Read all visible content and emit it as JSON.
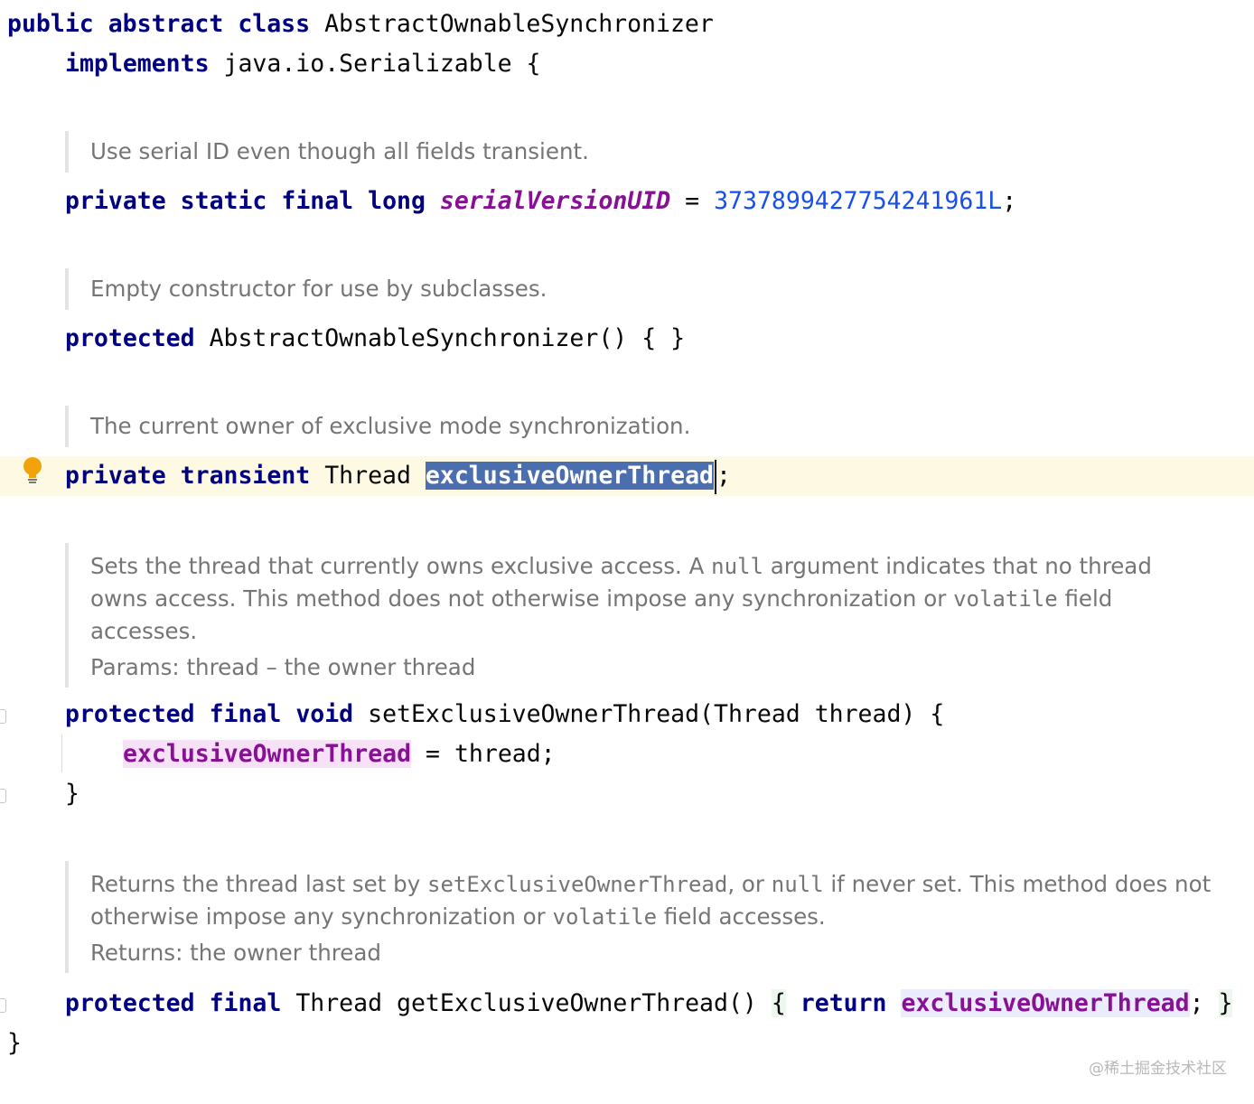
{
  "code": {
    "l1": {
      "kw1": "public",
      "kw2": "abstract",
      "kw3": "class",
      "name": "AbstractOwnableSynchronizer"
    },
    "l2": {
      "kw": "implements",
      "rest": "java.io.Serializable {"
    },
    "doc1": "Use serial ID even though all fields transient.",
    "l3": {
      "kw1": "private",
      "kw2": "static",
      "kw3": "final",
      "kw4": "long",
      "field": "serialVersionUID",
      "eq": "=",
      "num": "3737899427754241961L",
      "semi": ";"
    },
    "doc2": "Empty constructor for use by subclasses.",
    "l4": {
      "kw": "protected",
      "rest": "AbstractOwnableSynchronizer() { }"
    },
    "doc3": "The current owner of exclusive mode synchronization.",
    "l5": {
      "kw1": "private",
      "kw2": "transient",
      "type": "Thread",
      "field": "exclusiveOwnerThread",
      "semi": ";"
    },
    "doc4": {
      "t1": "Sets the thread that currently owns exclusive access. A ",
      "c1": "null",
      "t2": " argument indicates that no thread owns access. This method does not otherwise impose any synchronization or ",
      "c2": "volatile",
      "t3": " field accesses.",
      "params": "Params: thread – the owner thread"
    },
    "l6": {
      "kw1": "protected",
      "kw2": "final",
      "kw3": "void",
      "rest": "setExclusiveOwnerThread(Thread thread) {"
    },
    "l7": {
      "field": "exclusiveOwnerThread",
      "rest": " = thread;"
    },
    "l8": {
      "brace": "}"
    },
    "doc5": {
      "t1": "Returns the thread last set by ",
      "c1": "setExclusiveOwnerThread",
      "t2": ", or ",
      "c2": "null",
      "t3": " if never set. This method does not otherwise impose any synchronization or ",
      "c3": "volatile",
      "t4": " field accesses.",
      "returns": "Returns: the owner thread"
    },
    "l9": {
      "kw1": "protected",
      "kw2": "final",
      "type": "Thread",
      "method": "getExclusiveOwnerThread()",
      "ob": "{",
      "kw3": "return",
      "field": "exclusiveOwnerThread",
      "semi": ";",
      "cb": "}"
    },
    "l10": {
      "brace": "}"
    }
  },
  "watermark": "@稀土掘金技术社区",
  "icons": [
    "lightbulb-icon",
    "fold-marker-icon"
  ]
}
